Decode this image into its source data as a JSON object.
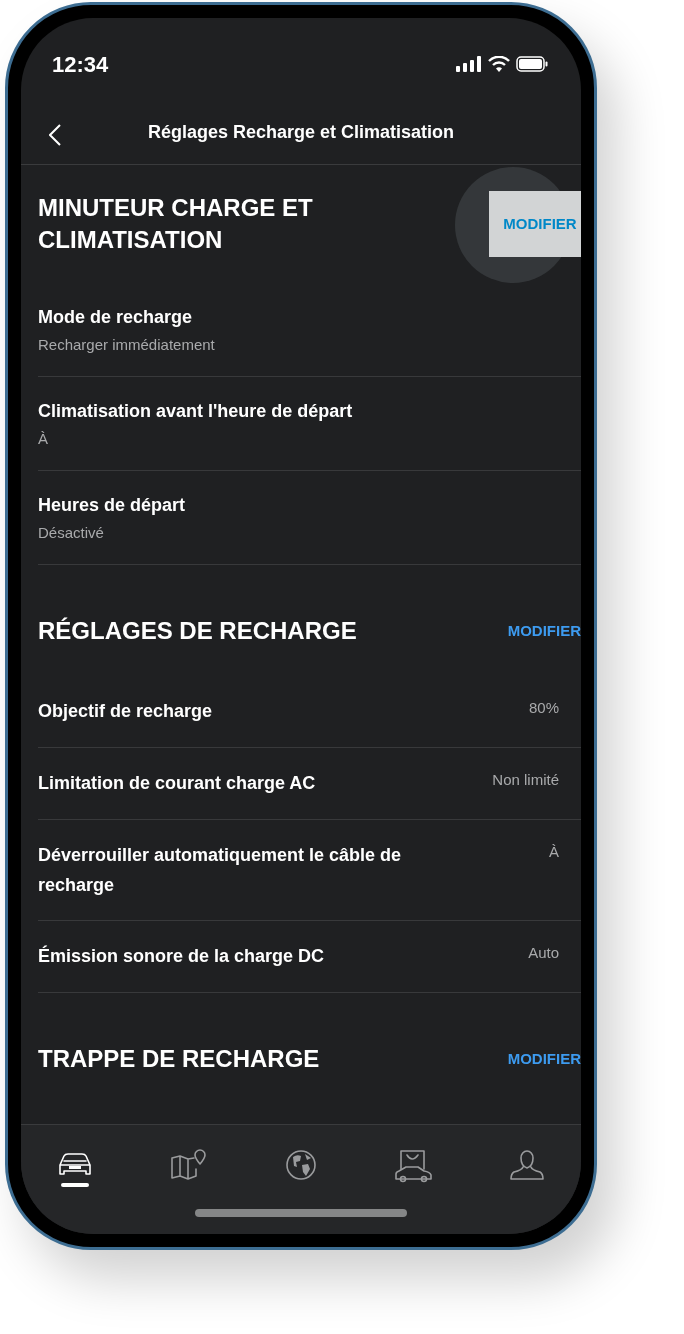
{
  "status_bar": {
    "time": "12:34"
  },
  "header": {
    "title": "Réglages Recharge et Climatisation"
  },
  "sections": [
    {
      "title": "MINUTEUR CHARGE ET CLIMATISATION",
      "action": {
        "label": "MODIFIER",
        "pressed": true
      },
      "kind": "stacked",
      "rows": [
        {
          "label": "Mode de recharge",
          "value": "Recharger immédiatement"
        },
        {
          "label": "Climatisation avant l'heure de départ",
          "value": "À"
        },
        {
          "label": "Heures de départ",
          "value": "Désactivé"
        }
      ]
    },
    {
      "title": "RÉGLAGES DE RECHARGE",
      "action": {
        "label": "MODIFIER",
        "pressed": false
      },
      "kind": "inline",
      "rows": [
        {
          "label": "Objectif de recharge",
          "value": "80%"
        },
        {
          "label": "Limitation de courant charge AC",
          "value": "Non limité"
        },
        {
          "label": "Déverrouiller automatiquement le câble de recharge",
          "value": "À"
        },
        {
          "label": "Émission sonore de la charge DC",
          "value": "Auto"
        }
      ]
    },
    {
      "title": "TRAPPE DE RECHARGE",
      "action": {
        "label": "MODIFIER",
        "pressed": false
      }
    }
  ],
  "tab_bar": [
    {
      "kind": "car",
      "selected": true
    },
    {
      "kind": "map",
      "selected": false
    },
    {
      "kind": "globe",
      "selected": false
    },
    {
      "kind": "shop",
      "selected": false
    },
    {
      "kind": "profile",
      "selected": false
    }
  ]
}
